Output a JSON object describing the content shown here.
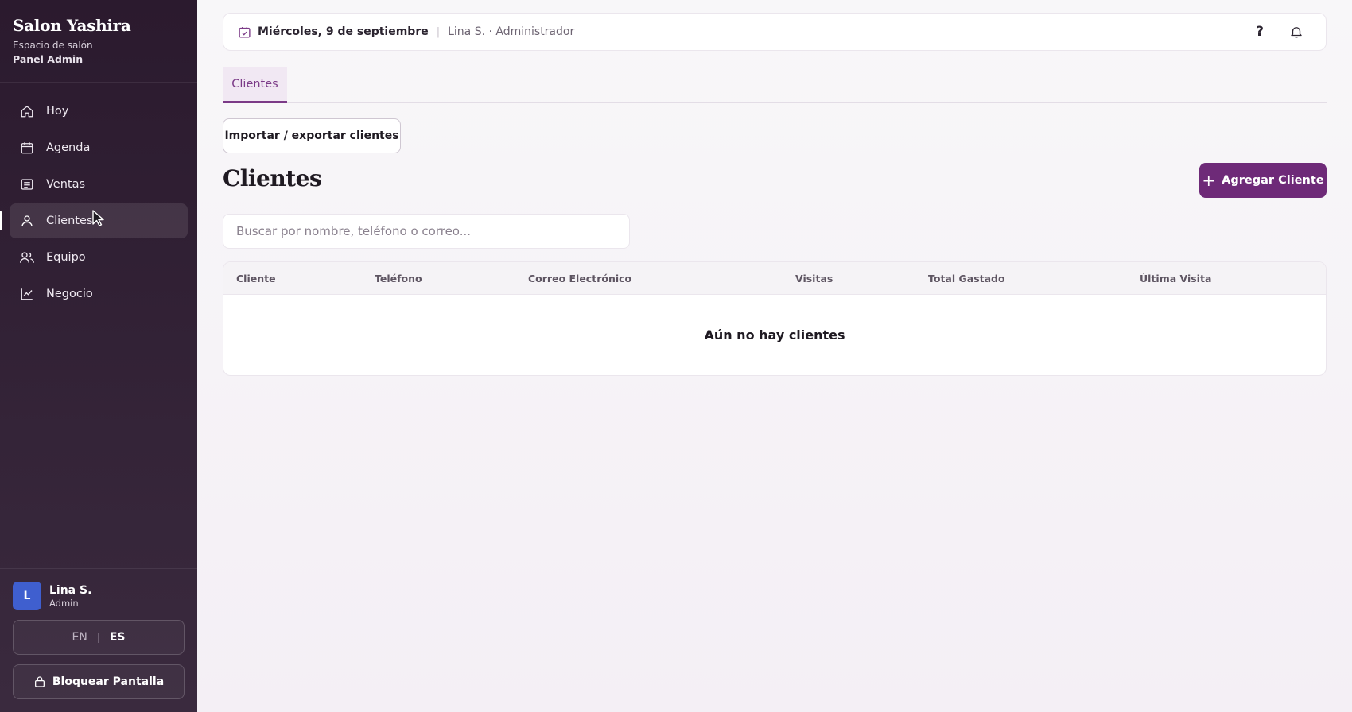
{
  "brand": {
    "title": "Salon Yashira",
    "subtitle": "Espacio de salón",
    "panel": "Panel Admin"
  },
  "nav": {
    "items": [
      {
        "label": "Hoy",
        "icon": "home-icon"
      },
      {
        "label": "Agenda",
        "icon": "calendar-icon"
      },
      {
        "label": "Ventas",
        "icon": "receipt-icon"
      },
      {
        "label": "Clientes",
        "icon": "user-icon",
        "active": true
      },
      {
        "label": "Equipo",
        "icon": "users-icon"
      },
      {
        "label": "Negocio",
        "icon": "chart-icon"
      }
    ]
  },
  "user": {
    "initial": "L",
    "name": "Lina S.",
    "role": "Admin"
  },
  "language": {
    "options": [
      "EN",
      "ES"
    ],
    "selected": "ES"
  },
  "lock_button": "Bloquear Pantalla",
  "topbar": {
    "date": "Miércoles, 9 de septiembre",
    "user": "Lina S. · Administrador",
    "help": "?"
  },
  "tabs": [
    {
      "label": "Clientes",
      "active": true
    }
  ],
  "import_button": "Importar / exportar clientes",
  "page_title": "Clientes",
  "add_button": "Agregar Cliente",
  "search": {
    "placeholder": "Buscar por nombre, teléfono o correo...",
    "value": ""
  },
  "table": {
    "columns": [
      "Cliente",
      "Teléfono",
      "Correo Electrónico",
      "Visitas",
      "Total Gastado",
      "Última Visita"
    ],
    "rows": [],
    "empty_message": "Aún no hay clientes"
  },
  "colors": {
    "sidebar": "#2b1a2e",
    "accent": "#6e2a78",
    "tab_accent": "#7b3a87",
    "avatar": "#3f5fcf"
  }
}
